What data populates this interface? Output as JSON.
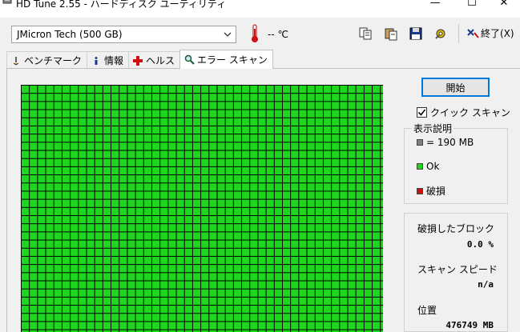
{
  "window": {
    "title": "HD Tune 2.55 - ハードディスク ユーティリティ",
    "minimize_glyph": "—",
    "maximize_glyph": "☐",
    "close_glyph": "✕"
  },
  "toolbar": {
    "drive": "JMicron Tech (500 GB)",
    "temperature": "-- ℃",
    "exit_label": "終了(X)"
  },
  "tabs": [
    {
      "label": "ベンチマーク",
      "icon": "speedometer-icon"
    },
    {
      "label": "情報",
      "icon": "info-icon"
    },
    {
      "label": "ヘルス",
      "icon": "health-cross-icon"
    },
    {
      "label": "エラー スキャン",
      "icon": "magnifier-icon",
      "active": true
    }
  ],
  "scan": {
    "start_label": "開始",
    "quick_scan_label": "クイック スキャン",
    "quick_scan_checked": true
  },
  "legend": {
    "title": "表示説明",
    "items": [
      {
        "label": "= 190 MB",
        "color": "#808080"
      },
      {
        "label": "Ok",
        "color": "#1fd61f"
      },
      {
        "label": "破損",
        "color": "#d01010"
      }
    ]
  },
  "stats": {
    "damaged_label": "破損したブロック",
    "damaged_value": "0.0 %",
    "speed_label": "スキャン スピード",
    "speed_value": "n/a",
    "position_label": "位置",
    "position_value": "476749 MB"
  },
  "colors": {
    "ok_green": "#1fd61f",
    "damaged_red": "#d01010",
    "block_gray": "#808080",
    "accent_blue": "#0078d7"
  }
}
